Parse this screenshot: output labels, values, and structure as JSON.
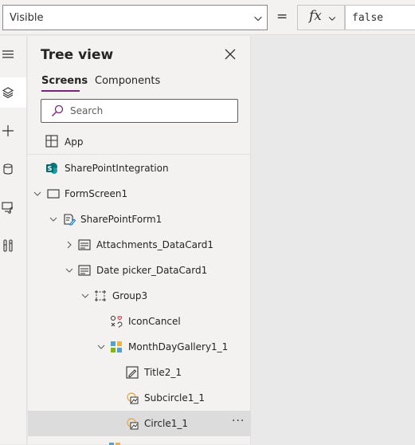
{
  "formula_bar": {
    "property": "Visible",
    "equals": "=",
    "fx_label": "fx",
    "formula": "false"
  },
  "rail": {
    "items": [
      {
        "icon": "hamburger-icon",
        "active": false
      },
      {
        "icon": "layers-icon",
        "active": true
      },
      {
        "icon": "plus-icon",
        "active": false
      },
      {
        "icon": "database-icon",
        "active": false
      },
      {
        "icon": "media-icon",
        "active": false
      },
      {
        "icon": "tools-icon",
        "active": false
      }
    ]
  },
  "tree_view": {
    "title": "Tree view",
    "tabs": [
      "Screens",
      "Components"
    ],
    "active_tab": "Screens",
    "search_placeholder": "Search",
    "app_label": "App",
    "rows": [
      {
        "label": "SharePointIntegration",
        "icon": "sharepoint-icon",
        "caret": "none",
        "level": 0
      },
      {
        "label": "FormScreen1",
        "icon": "screen-icon",
        "caret": "expanded",
        "level": 0
      },
      {
        "label": "SharePointForm1",
        "icon": "form-icon",
        "caret": "expanded",
        "level": 1
      },
      {
        "label": "Attachments_DataCard1",
        "icon": "datacard-icon",
        "caret": "collapsed",
        "level": 2
      },
      {
        "label": "Date picker_DataCard1",
        "icon": "datacard-icon",
        "caret": "expanded",
        "level": 2
      },
      {
        "label": "Group3",
        "icon": "group-icon",
        "caret": "expanded",
        "level": 3
      },
      {
        "label": "IconCancel",
        "icon": "shapes-icon",
        "caret": "none",
        "level": 4
      },
      {
        "label": "MonthDayGallery1_1",
        "icon": "gallery-icon",
        "caret": "expanded",
        "level": 4
      },
      {
        "label": "Title2_1",
        "icon": "edit-label-icon",
        "caret": "none",
        "level": 5
      },
      {
        "label": "Subcircle1_1",
        "icon": "circle-shape-icon",
        "caret": "none",
        "level": 5
      },
      {
        "label": "Circle1_1",
        "icon": "circle-shape-icon",
        "caret": "none",
        "level": 5,
        "selected": true
      }
    ],
    "more_label": "···"
  }
}
